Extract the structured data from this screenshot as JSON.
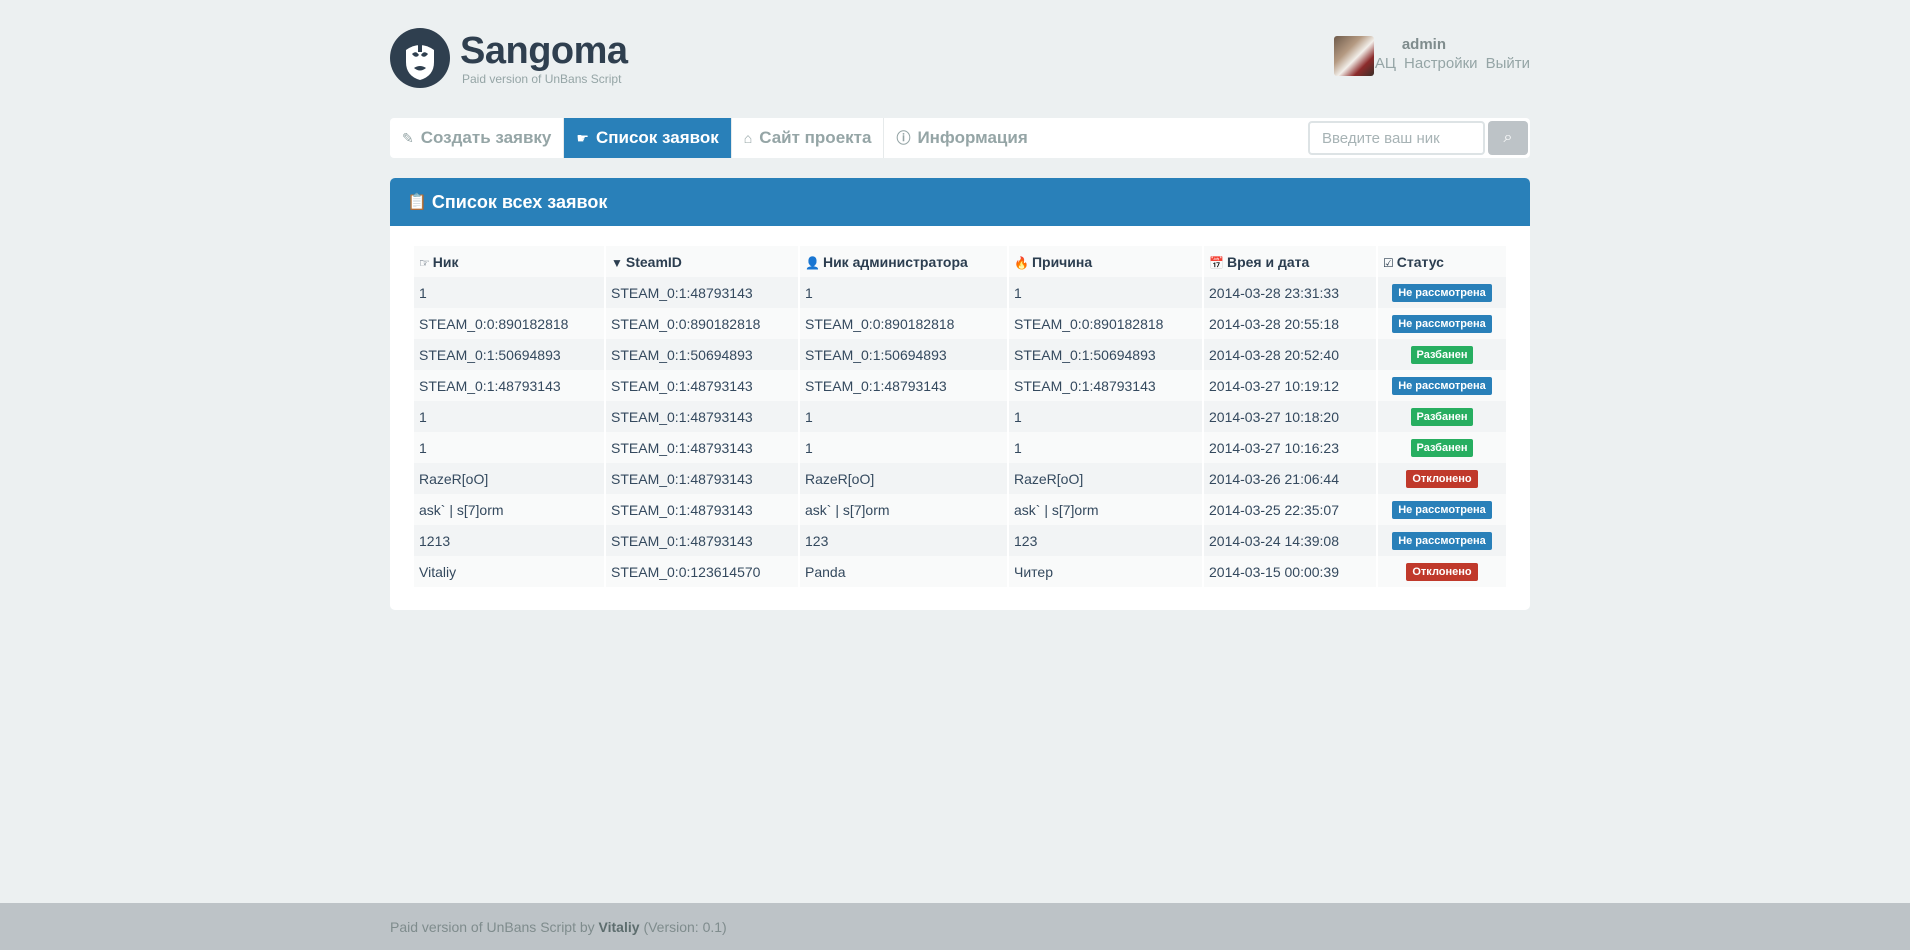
{
  "brand": {
    "title": "Sangoma",
    "subtitle": "Paid version of UnBans Script"
  },
  "user": {
    "name": "admin",
    "links": [
      "АЦ",
      "Настройки",
      "Выйти"
    ]
  },
  "nav": {
    "items": [
      {
        "label": "Создать заявку",
        "icon": "pencil-icon",
        "active": false
      },
      {
        "label": "Список заявок",
        "icon": "hand-icon",
        "active": true
      },
      {
        "label": "Сайт проекта",
        "icon": "home-icon",
        "active": false
      },
      {
        "label": "Информация",
        "icon": "info-icon",
        "active": false
      }
    ],
    "search": {
      "placeholder": "Введите ваш ник",
      "value": ""
    }
  },
  "panel": {
    "title": "Список всех заявок",
    "columns": [
      {
        "label": "Ник",
        "icon": "hand-point-icon"
      },
      {
        "label": "SteamID",
        "icon": "filter-icon"
      },
      {
        "label": "Ник администратора",
        "icon": "user-icon"
      },
      {
        "label": "Причина",
        "icon": "fire-icon"
      },
      {
        "label": "Врея и дата",
        "icon": "calendar-icon"
      },
      {
        "label": "Статус",
        "icon": "check-icon"
      }
    ],
    "rows": [
      [
        "1",
        "STEAM_0:1:48793143",
        "1",
        "1",
        "2014-03-28 23:31:33",
        "Не рассмотрена"
      ],
      [
        "STEAM_0:0:890182818",
        "STEAM_0:0:890182818",
        "STEAM_0:0:890182818",
        "STEAM_0:0:890182818",
        "2014-03-28 20:55:18",
        "Не рассмотрена"
      ],
      [
        "STEAM_0:1:50694893",
        "STEAM_0:1:50694893",
        "STEAM_0:1:50694893",
        "STEAM_0:1:50694893",
        "2014-03-28 20:52:40",
        "Разбанен"
      ],
      [
        "STEAM_0:1:48793143",
        "STEAM_0:1:48793143",
        "STEAM_0:1:48793143",
        "STEAM_0:1:48793143",
        "2014-03-27 10:19:12",
        "Не рассмотрена"
      ],
      [
        "1",
        "STEAM_0:1:48793143",
        "1",
        "1",
        "2014-03-27 10:18:20",
        "Разбанен"
      ],
      [
        "1",
        "STEAM_0:1:48793143",
        "1",
        "1",
        "2014-03-27 10:16:23",
        "Разбанен"
      ],
      [
        "RazeR[oO]",
        "STEAM_0:1:48793143",
        "RazeR[oO]",
        "RazeR[oO]",
        "2014-03-26 21:06:44",
        "Отклонено"
      ],
      [
        "ask` | s[7]orm",
        "STEAM_0:1:48793143",
        "ask` | s[7]orm",
        "ask` | s[7]orm",
        "2014-03-25 22:35:07",
        "Не рассмотрена"
      ],
      [
        "1213",
        "STEAM_0:1:48793143",
        "123",
        "123",
        "2014-03-24 14:39:08",
        "Не рассмотрена"
      ],
      [
        "Vitaliy",
        "STEAM_0:0:123614570",
        "Panda",
        "Читер",
        "2014-03-15 00:00:39",
        "Отклонено"
      ]
    ],
    "status_colors": {
      "Не рассмотрена": "#2980b9",
      "Разбанен": "#27ae60",
      "Отклонено": "#c0392b"
    }
  },
  "footer": {
    "prefix": "Paid version of UnBans Script by",
    "author": "Vitaliy",
    "version": "(Version: 0.1)"
  }
}
